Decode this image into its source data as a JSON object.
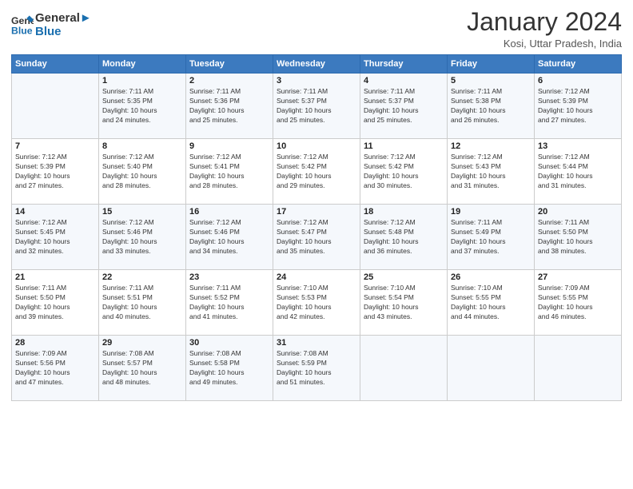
{
  "header": {
    "logo_line1": "General",
    "logo_line2": "Blue",
    "month_title": "January 2024",
    "location": "Kosi, Uttar Pradesh, India"
  },
  "weekdays": [
    "Sunday",
    "Monday",
    "Tuesday",
    "Wednesday",
    "Thursday",
    "Friday",
    "Saturday"
  ],
  "weeks": [
    [
      {
        "day": "",
        "info": ""
      },
      {
        "day": "1",
        "info": "Sunrise: 7:11 AM\nSunset: 5:35 PM\nDaylight: 10 hours\nand 24 minutes."
      },
      {
        "day": "2",
        "info": "Sunrise: 7:11 AM\nSunset: 5:36 PM\nDaylight: 10 hours\nand 25 minutes."
      },
      {
        "day": "3",
        "info": "Sunrise: 7:11 AM\nSunset: 5:37 PM\nDaylight: 10 hours\nand 25 minutes."
      },
      {
        "day": "4",
        "info": "Sunrise: 7:11 AM\nSunset: 5:37 PM\nDaylight: 10 hours\nand 25 minutes."
      },
      {
        "day": "5",
        "info": "Sunrise: 7:11 AM\nSunset: 5:38 PM\nDaylight: 10 hours\nand 26 minutes."
      },
      {
        "day": "6",
        "info": "Sunrise: 7:12 AM\nSunset: 5:39 PM\nDaylight: 10 hours\nand 27 minutes."
      }
    ],
    [
      {
        "day": "7",
        "info": "Sunrise: 7:12 AM\nSunset: 5:39 PM\nDaylight: 10 hours\nand 27 minutes."
      },
      {
        "day": "8",
        "info": "Sunrise: 7:12 AM\nSunset: 5:40 PM\nDaylight: 10 hours\nand 28 minutes."
      },
      {
        "day": "9",
        "info": "Sunrise: 7:12 AM\nSunset: 5:41 PM\nDaylight: 10 hours\nand 28 minutes."
      },
      {
        "day": "10",
        "info": "Sunrise: 7:12 AM\nSunset: 5:42 PM\nDaylight: 10 hours\nand 29 minutes."
      },
      {
        "day": "11",
        "info": "Sunrise: 7:12 AM\nSunset: 5:42 PM\nDaylight: 10 hours\nand 30 minutes."
      },
      {
        "day": "12",
        "info": "Sunrise: 7:12 AM\nSunset: 5:43 PM\nDaylight: 10 hours\nand 31 minutes."
      },
      {
        "day": "13",
        "info": "Sunrise: 7:12 AM\nSunset: 5:44 PM\nDaylight: 10 hours\nand 31 minutes."
      }
    ],
    [
      {
        "day": "14",
        "info": "Sunrise: 7:12 AM\nSunset: 5:45 PM\nDaylight: 10 hours\nand 32 minutes."
      },
      {
        "day": "15",
        "info": "Sunrise: 7:12 AM\nSunset: 5:46 PM\nDaylight: 10 hours\nand 33 minutes."
      },
      {
        "day": "16",
        "info": "Sunrise: 7:12 AM\nSunset: 5:46 PM\nDaylight: 10 hours\nand 34 minutes."
      },
      {
        "day": "17",
        "info": "Sunrise: 7:12 AM\nSunset: 5:47 PM\nDaylight: 10 hours\nand 35 minutes."
      },
      {
        "day": "18",
        "info": "Sunrise: 7:12 AM\nSunset: 5:48 PM\nDaylight: 10 hours\nand 36 minutes."
      },
      {
        "day": "19",
        "info": "Sunrise: 7:11 AM\nSunset: 5:49 PM\nDaylight: 10 hours\nand 37 minutes."
      },
      {
        "day": "20",
        "info": "Sunrise: 7:11 AM\nSunset: 5:50 PM\nDaylight: 10 hours\nand 38 minutes."
      }
    ],
    [
      {
        "day": "21",
        "info": "Sunrise: 7:11 AM\nSunset: 5:50 PM\nDaylight: 10 hours\nand 39 minutes."
      },
      {
        "day": "22",
        "info": "Sunrise: 7:11 AM\nSunset: 5:51 PM\nDaylight: 10 hours\nand 40 minutes."
      },
      {
        "day": "23",
        "info": "Sunrise: 7:11 AM\nSunset: 5:52 PM\nDaylight: 10 hours\nand 41 minutes."
      },
      {
        "day": "24",
        "info": "Sunrise: 7:10 AM\nSunset: 5:53 PM\nDaylight: 10 hours\nand 42 minutes."
      },
      {
        "day": "25",
        "info": "Sunrise: 7:10 AM\nSunset: 5:54 PM\nDaylight: 10 hours\nand 43 minutes."
      },
      {
        "day": "26",
        "info": "Sunrise: 7:10 AM\nSunset: 5:55 PM\nDaylight: 10 hours\nand 44 minutes."
      },
      {
        "day": "27",
        "info": "Sunrise: 7:09 AM\nSunset: 5:55 PM\nDaylight: 10 hours\nand 46 minutes."
      }
    ],
    [
      {
        "day": "28",
        "info": "Sunrise: 7:09 AM\nSunset: 5:56 PM\nDaylight: 10 hours\nand 47 minutes."
      },
      {
        "day": "29",
        "info": "Sunrise: 7:08 AM\nSunset: 5:57 PM\nDaylight: 10 hours\nand 48 minutes."
      },
      {
        "day": "30",
        "info": "Sunrise: 7:08 AM\nSunset: 5:58 PM\nDaylight: 10 hours\nand 49 minutes."
      },
      {
        "day": "31",
        "info": "Sunrise: 7:08 AM\nSunset: 5:59 PM\nDaylight: 10 hours\nand 51 minutes."
      },
      {
        "day": "",
        "info": ""
      },
      {
        "day": "",
        "info": ""
      },
      {
        "day": "",
        "info": ""
      }
    ]
  ]
}
